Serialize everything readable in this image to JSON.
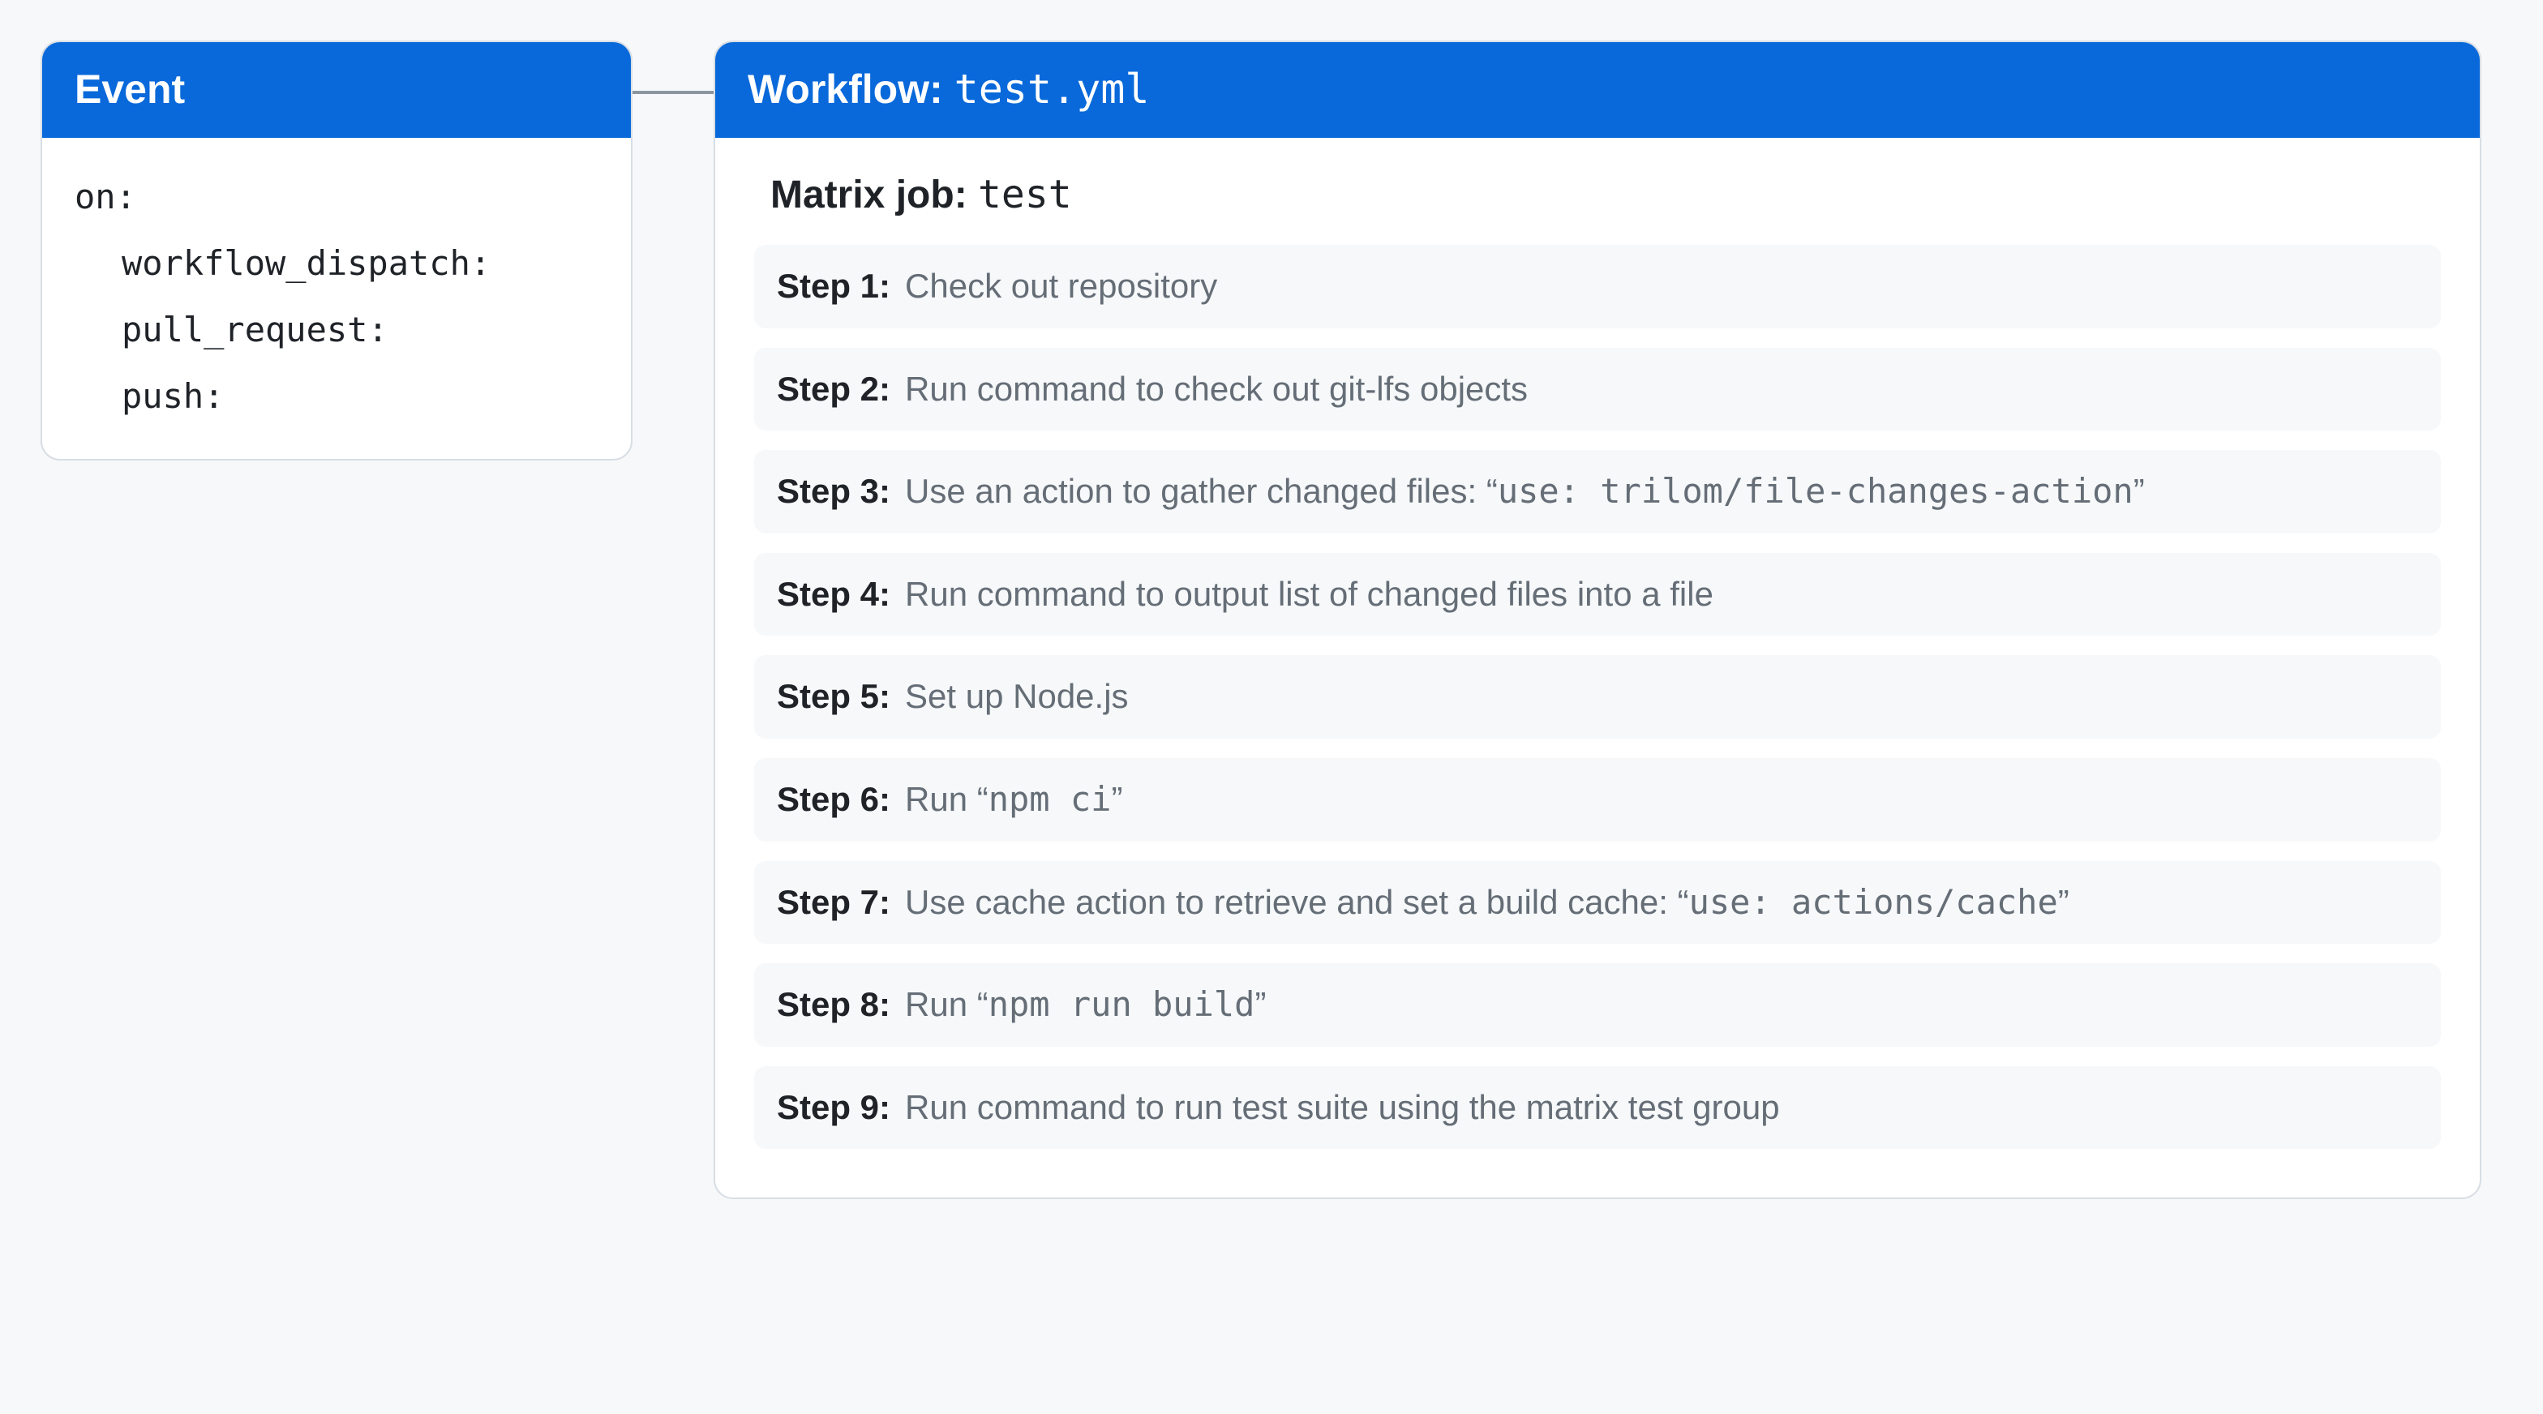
{
  "event": {
    "header": "Event",
    "trigger_key": "on:",
    "triggers": [
      "workflow_dispatch:",
      "pull_request:",
      "push:"
    ]
  },
  "workflow": {
    "header_prefix": "Workflow: ",
    "header_file": "test.yml",
    "matrix_prefix": "Matrix job: ",
    "matrix_name": "test",
    "steps": [
      {
        "label": "Step 1:",
        "plain": "Check out repository"
      },
      {
        "label": "Step 2:",
        "plain": "Run command to check out git-lfs objects"
      },
      {
        "label": "Step 3:",
        "before": "Use an action to gather changed files: “",
        "code": "use: trilom/file-changes-action",
        "after": "”"
      },
      {
        "label": "Step 4:",
        "plain": "Run command to output list of changed files into a file"
      },
      {
        "label": "Step 5:",
        "plain": "Set up Node.js"
      },
      {
        "label": "Step 6:",
        "before": "Run “",
        "code": "npm ci",
        "after": "”"
      },
      {
        "label": "Step 7:",
        "before": "Use cache action to retrieve and set a build cache: “",
        "code": "use: actions/cache",
        "after": "”"
      },
      {
        "label": "Step 8:",
        "before": "Run “",
        "code": "npm run build",
        "after": "”"
      },
      {
        "label": "Step 9:",
        "plain": "Run command to run test suite using the matrix test group"
      }
    ]
  }
}
